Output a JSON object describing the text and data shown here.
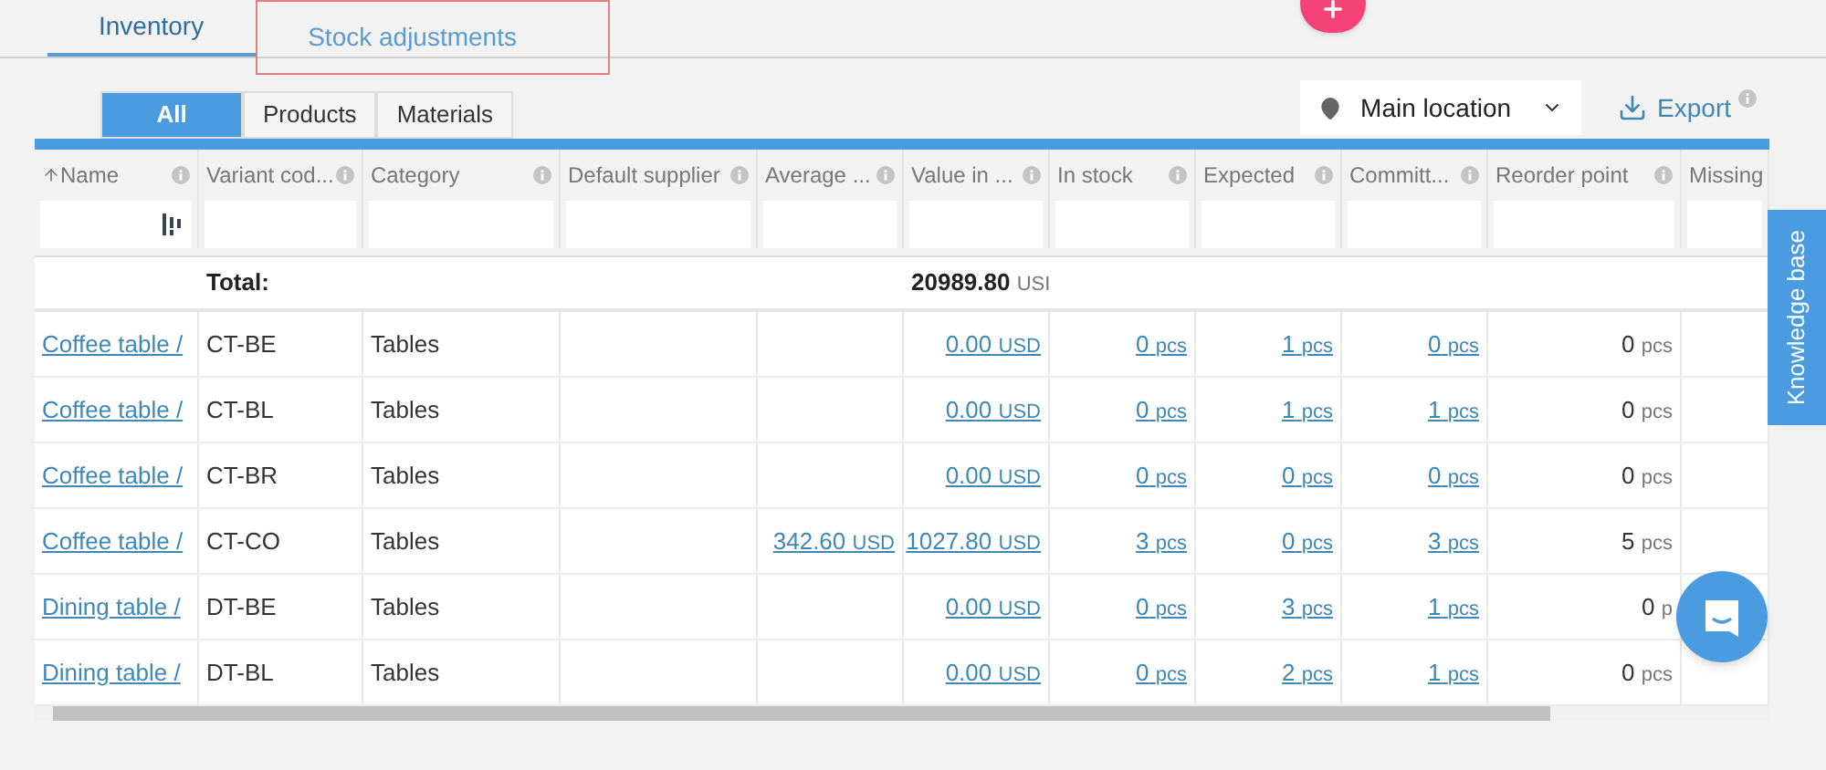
{
  "tabs": [
    {
      "label": "Inventory",
      "selected": true,
      "highlighted": false
    },
    {
      "label": "Stock adjustments",
      "selected": false,
      "highlighted": true
    }
  ],
  "filter_tabs": [
    {
      "label": "All",
      "selected": true
    },
    {
      "label": "Products",
      "selected": false
    },
    {
      "label": "Materials",
      "selected": false
    }
  ],
  "location": {
    "value": "Main location"
  },
  "export": {
    "label": "Export"
  },
  "table": {
    "columns": [
      {
        "label": "Name",
        "kind": "link",
        "sorted": true
      },
      {
        "label": "Variant cod...",
        "kind": "text",
        "sorted": false
      },
      {
        "label": "Category",
        "kind": "text",
        "sorted": false
      },
      {
        "label": "Default supplier",
        "sorted": false
      },
      {
        "label": "Average ...",
        "kind": "amount_link",
        "sorted": false
      },
      {
        "label": "Value in ...",
        "kind": "amount_link",
        "sorted": false
      },
      {
        "label": "In stock",
        "kind": "amount_link",
        "sorted": false
      },
      {
        "label": "Expected",
        "kind": "amount_link",
        "sorted": false
      },
      {
        "label": "Committ...",
        "kind": "amount_link",
        "sorted": false
      },
      {
        "label": "Reorder point",
        "kind": "amount",
        "sorted": false
      },
      {
        "label": "Missing",
        "sorted": false
      }
    ],
    "total": {
      "label": "Total:",
      "amount": "20989.80",
      "unit": "USI"
    },
    "rows": [
      {
        "cells": [
          "Coffee table /",
          "CT-BE",
          "Tables",
          null,
          null,
          {
            "amount": "0.00",
            "unit": "USD"
          },
          {
            "amount": "0",
            "unit": "pcs"
          },
          {
            "amount": "1",
            "unit": "pcs"
          },
          {
            "amount": "0",
            "unit": "pcs"
          },
          {
            "amount": "0",
            "unit": "pcs"
          },
          null
        ]
      },
      {
        "cells": [
          "Coffee table /",
          "CT-BL",
          "Tables",
          null,
          null,
          {
            "amount": "0.00",
            "unit": "USD"
          },
          {
            "amount": "0",
            "unit": "pcs"
          },
          {
            "amount": "1",
            "unit": "pcs"
          },
          {
            "amount": "1",
            "unit": "pcs"
          },
          {
            "amount": "0",
            "unit": "pcs"
          },
          null
        ]
      },
      {
        "cells": [
          "Coffee table /",
          "CT-BR",
          "Tables",
          null,
          null,
          {
            "amount": "0.00",
            "unit": "USD"
          },
          {
            "amount": "0",
            "unit": "pcs"
          },
          {
            "amount": "0",
            "unit": "pcs"
          },
          {
            "amount": "0",
            "unit": "pcs"
          },
          {
            "amount": "0",
            "unit": "pcs"
          },
          null
        ]
      },
      {
        "cells": [
          "Coffee table /",
          "CT-CO",
          "Tables",
          null,
          {
            "amount": "342.60",
            "unit": "USD"
          },
          {
            "amount": "1027.80",
            "unit": "USD"
          },
          {
            "amount": "3",
            "unit": "pcs"
          },
          {
            "amount": "0",
            "unit": "pcs"
          },
          {
            "amount": "3",
            "unit": "pcs"
          },
          {
            "amount": "5",
            "unit": "pcs"
          },
          null
        ]
      },
      {
        "cells": [
          "Dining table /",
          "DT-BE",
          "Tables",
          null,
          null,
          {
            "amount": "0.00",
            "unit": "USD"
          },
          {
            "amount": "0",
            "unit": "pcs"
          },
          {
            "amount": "3",
            "unit": "pcs"
          },
          {
            "amount": "1",
            "unit": "pcs"
          },
          {
            "amount": "0",
            "unit": "p"
          },
          null
        ]
      },
      {
        "cells": [
          "Dining table /",
          "DT-BL",
          "Tables",
          null,
          null,
          {
            "amount": "0.00",
            "unit": "USD"
          },
          {
            "amount": "0",
            "unit": "pcs"
          },
          {
            "amount": "2",
            "unit": "pcs"
          },
          {
            "amount": "1",
            "unit": "pcs"
          },
          {
            "amount": "0",
            "unit": "pcs"
          },
          null
        ]
      }
    ]
  },
  "knowledge_base": {
    "label": "Knowledge base"
  }
}
